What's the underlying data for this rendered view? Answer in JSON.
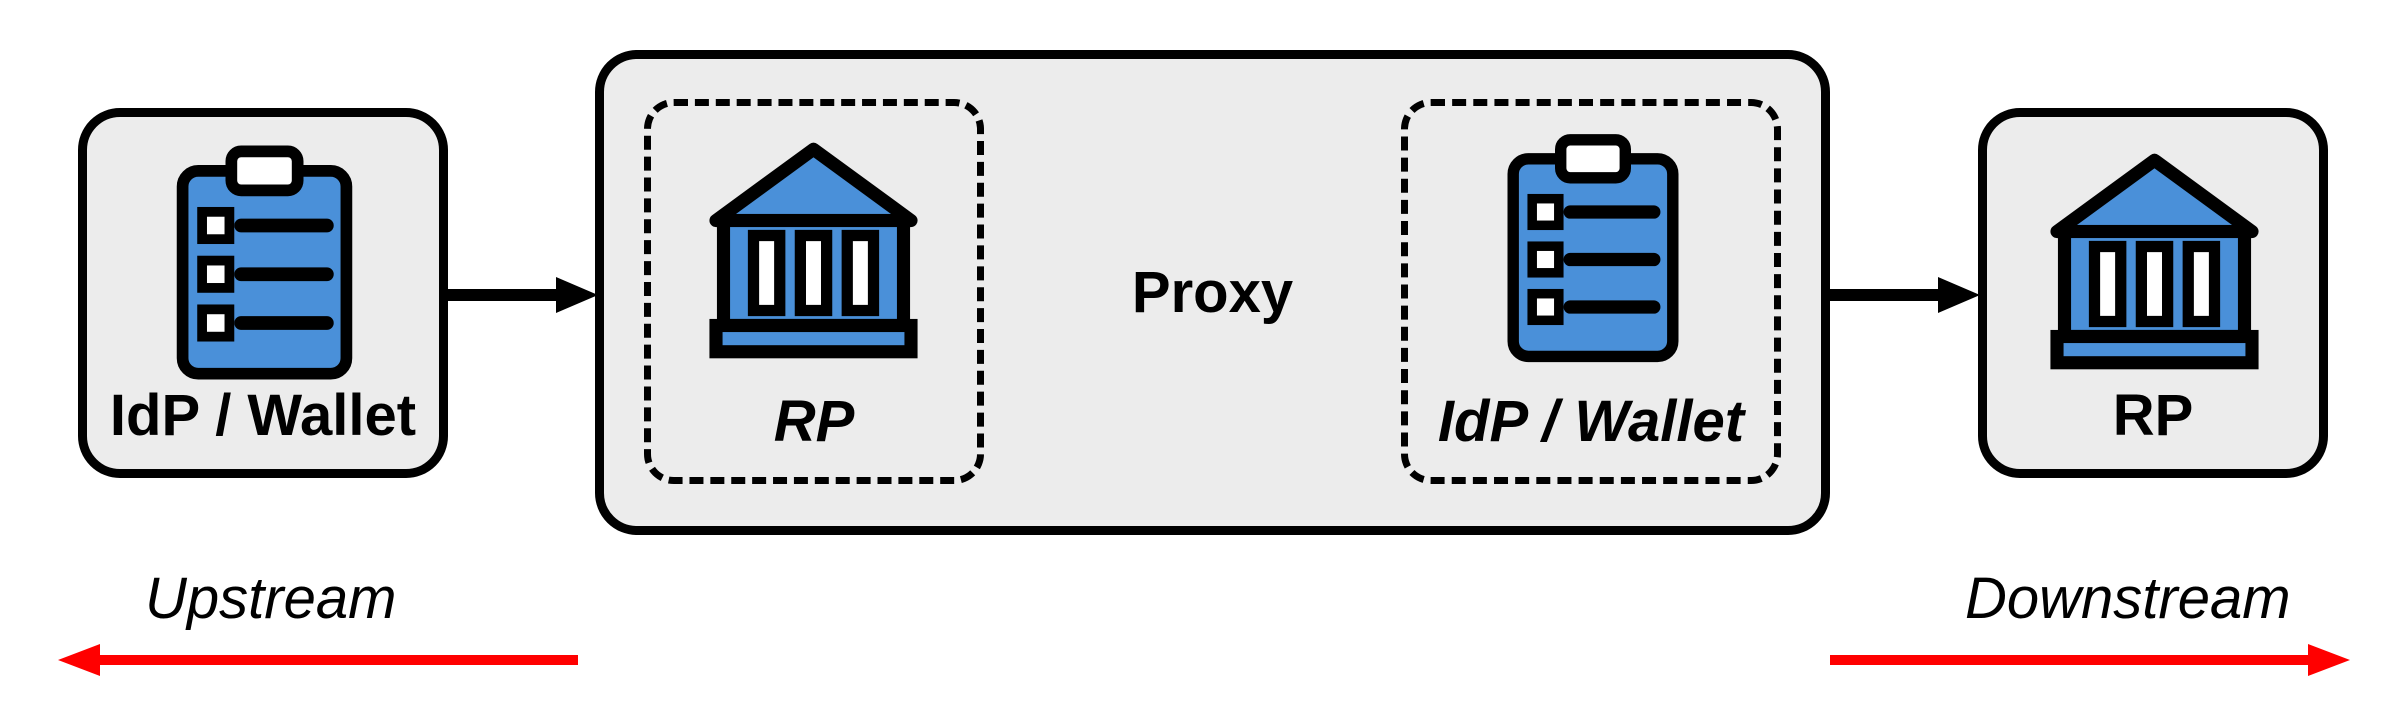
{
  "boxes": {
    "left": {
      "label": "IdP / Wallet",
      "icon": "clipboard"
    },
    "center": {
      "label": "Proxy",
      "inner_left": {
        "label": "RP",
        "icon": "bank"
      },
      "inner_right": {
        "label": "IdP / Wallet",
        "icon": "clipboard"
      }
    },
    "right": {
      "label": "RP",
      "icon": "bank"
    }
  },
  "flows": {
    "upstream": "Upstream",
    "downstream": "Downstream"
  },
  "colors": {
    "fill": "#4a90d9",
    "stroke": "#000000",
    "arrow_red": "#ff0000",
    "box_bg": "#ececec"
  }
}
